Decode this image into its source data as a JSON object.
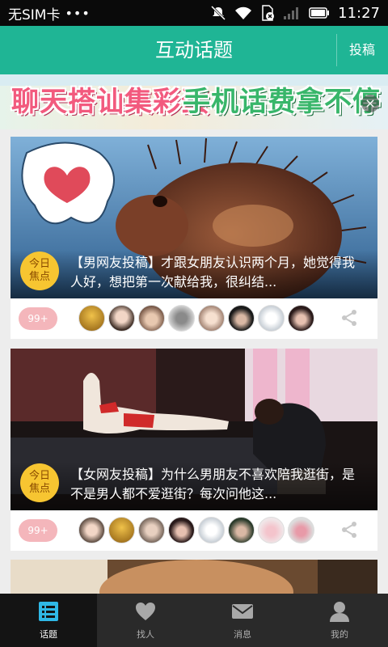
{
  "status_bar": {
    "carrier": "无SIM卡",
    "dots": "•••",
    "time": "11:27"
  },
  "header": {
    "title": "互动话题",
    "contribute_label": "投稿"
  },
  "banner": {
    "text_left": "聊天搭讪集彩蛋",
    "text_right": "手机话费拿不停",
    "close_label": "×"
  },
  "topics": [
    {
      "badge": "今日\n焦点",
      "badge_line1": "今日",
      "badge_line2": "焦点",
      "caption": "【男网友投稿】才跟女朋友认识两个月，她觉得我人好，想把第一次献给我，很纠结...",
      "count": "99+"
    },
    {
      "badge_line1": "今日",
      "badge_line2": "焦点",
      "caption": "【女网友投稿】为什么男朋友不喜欢陪我逛街，是不是男人都不爱逛街？每次问他这...",
      "count": "99+"
    }
  ],
  "tabbar": {
    "tabs": [
      {
        "label": "话题",
        "icon": "list-icon"
      },
      {
        "label": "找人",
        "icon": "heart-icon"
      },
      {
        "label": "消息",
        "icon": "mail-icon"
      },
      {
        "label": "我的",
        "icon": "user-icon"
      }
    ]
  },
  "colors": {
    "brand": "#1fb595",
    "badge": "#f7c531",
    "count_pill": "#f4b6bb",
    "tab_active_icon": "#2fb8e6"
  }
}
